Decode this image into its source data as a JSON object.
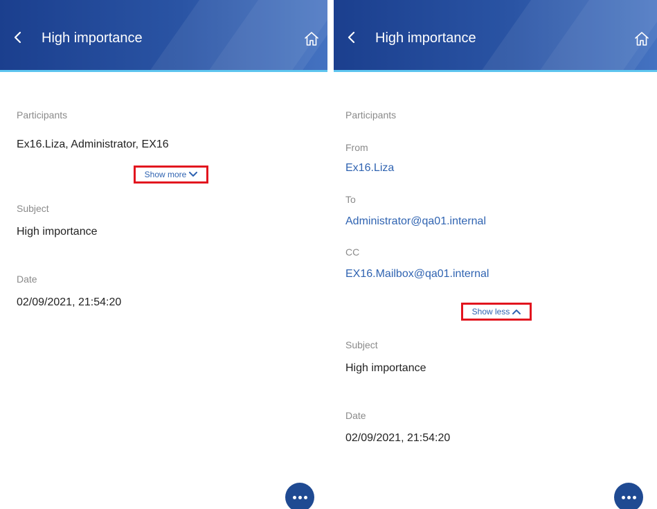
{
  "left": {
    "header": {
      "title": "High importance",
      "back_icon": "chevron-left-icon",
      "home_icon": "home-icon"
    },
    "participants_label": "Participants",
    "participants_value": "Ex16.Liza, Administrator, EX16",
    "toggle_label": "Show more",
    "subject_label": "Subject",
    "subject_value": "High importance",
    "date_label": "Date",
    "date_value": "02/09/2021, 21:54:20",
    "fab_icon": "more-icon"
  },
  "right": {
    "header": {
      "title": "High importance",
      "back_icon": "chevron-left-icon",
      "home_icon": "home-icon"
    },
    "participants_label": "Participants",
    "from_label": "From",
    "from_value": "Ex16.Liza",
    "to_label": "To",
    "to_value": "Administrator@qa01.internal",
    "cc_label": "CC",
    "cc_value": "EX16.Mailbox@qa01.internal",
    "toggle_label": "Show less",
    "subject_label": "Subject",
    "subject_value": "High importance",
    "date_label": "Date",
    "date_value": "02/09/2021, 21:54:20",
    "fab_icon": "more-icon"
  },
  "colors": {
    "header_dark": "#1b3f8e",
    "header_light": "#4472c1",
    "accent_line": "#5ec5ef",
    "link": "#2f63b1",
    "highlight_box": "#e2141e"
  }
}
